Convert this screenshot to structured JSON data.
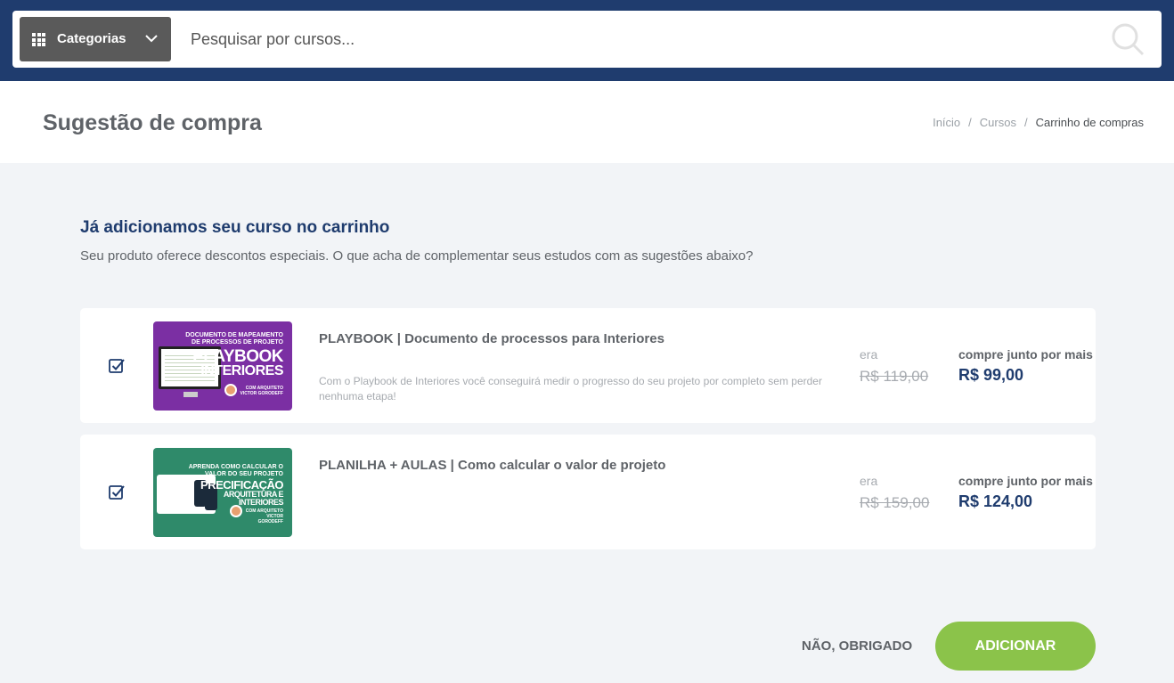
{
  "header": {
    "categories_label": "Categorias",
    "search_placeholder": "Pesquisar por cursos..."
  },
  "page": {
    "title": "Sugestão de compra",
    "breadcrumb": [
      "Início",
      "Cursos",
      "Carrinho de compras"
    ]
  },
  "intro": {
    "title": "Já adicionamos seu curso no carrinho",
    "subtitle": "Seu produto oferece descontos especiais. O que acha de complementar seus estudos com as sugestões abaixo?"
  },
  "products": [
    {
      "checked": true,
      "thumb": {
        "top": "DOCUMENTO DE MAPEAMENTO DE PROCESSOS DE PROJETO",
        "big1": "PLAYBOOK",
        "big2": "INTERIORES",
        "author": "COM ARQUITETO VICTOR GORODEFF"
      },
      "title": "PLAYBOOK | Documento de processos para Interiores",
      "description": "Com o Playbook de Interiores você conseguirá medir o progresso do seu projeto por completo sem perder nenhuma etapa!",
      "era_label": "era",
      "old_price": "R$ 119,00",
      "together_label": "compre junto por mais",
      "new_price": "R$ 99,00"
    },
    {
      "checked": true,
      "thumb": {
        "top": "APRENDA COMO CALCULAR O VALOR DO SEU PROJETO",
        "big1": "PRECIFICAÇÃO",
        "big2": "ARQUITETURA E INTERIORES",
        "author": "COM ARQUITETO VICTOR GORODEFF"
      },
      "title": "PLANILHA + AULAS | Como calcular o valor de projeto",
      "description": "",
      "era_label": "era",
      "old_price": "R$ 159,00",
      "together_label": "compre junto por mais",
      "new_price": "R$ 124,00"
    }
  ],
  "actions": {
    "decline": "NÃO, OBRIGADO",
    "add": "ADICIONAR"
  },
  "colors": {
    "navy": "#1f3c6e",
    "green_button": "#8bc34a",
    "purple_thumb": "#7b2fa3",
    "green_thumb": "#2f8a6a"
  }
}
